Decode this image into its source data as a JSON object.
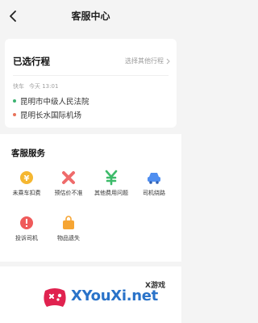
{
  "nav": {
    "title": "客服中心"
  },
  "trip": {
    "heading": "已选行程",
    "other_link": "选择其他行程",
    "ride_type": "快车",
    "time": "今天 13:01",
    "start": "昆明市中级人民法院",
    "end": "昆明长水国际机场",
    "start_color": "#3cb371",
    "end_color": "#e8735a"
  },
  "services": {
    "heading": "客服服务",
    "items": [
      {
        "label": "未乘车扣费",
        "icon": "coin-icon",
        "color": "#f5b731"
      },
      {
        "label": "预估价不准",
        "icon": "cross-icon",
        "color": "#ef6b6b"
      },
      {
        "label": "其他费用问题",
        "icon": "yen-icon",
        "color": "#3dbb6a"
      },
      {
        "label": "司机绕路",
        "icon": "car-icon",
        "color": "#4f8ef0"
      },
      {
        "label": "投诉司机",
        "icon": "complaint-icon",
        "color": "#ef5a5a"
      },
      {
        "label": "物品遗失",
        "icon": "bag-icon",
        "color": "#f6a533"
      }
    ]
  },
  "watermark": {
    "text": "XYouXi.net",
    "tag": "X游戏"
  }
}
